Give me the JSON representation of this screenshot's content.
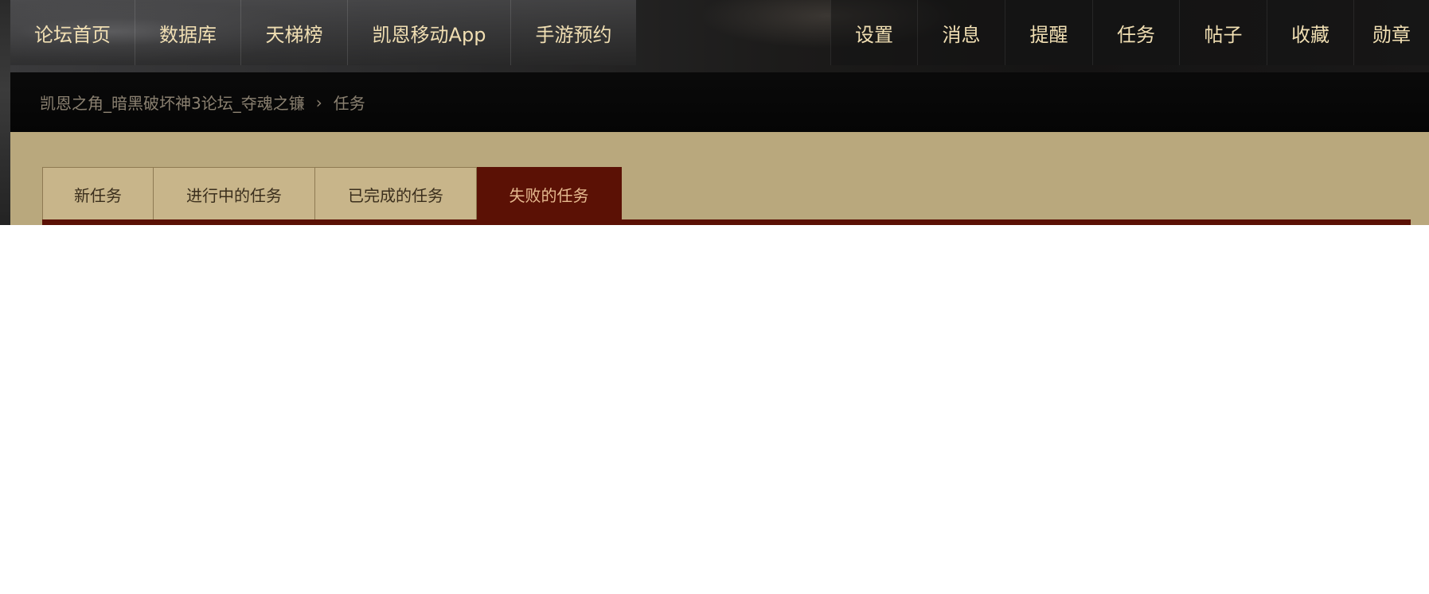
{
  "top_nav": {
    "left_items": [
      {
        "label": "论坛首页"
      },
      {
        "label": "数据库"
      },
      {
        "label": "天梯榜"
      },
      {
        "label": "凯恩移动App"
      },
      {
        "label": "手游预约"
      }
    ],
    "right_items": [
      {
        "label": "设置"
      },
      {
        "label": "消息"
      },
      {
        "label": "提醒"
      },
      {
        "label": "任务"
      },
      {
        "label": "帖子"
      },
      {
        "label": "收藏"
      },
      {
        "label": "勋章"
      }
    ]
  },
  "breadcrumb": {
    "home": "凯恩之角_暗黑破坏神3论坛_夺魂之镰",
    "separator": "›",
    "current": "任务"
  },
  "tabs": {
    "items": [
      {
        "label": "新任务",
        "active": false
      },
      {
        "label": "进行中的任务",
        "active": false
      },
      {
        "label": "已完成的任务",
        "active": false
      },
      {
        "label": "失败的任务",
        "active": true
      }
    ]
  },
  "colors": {
    "nav_text": "#f1dfb3",
    "content_bg": "#b9a87d",
    "tab_bg": "#c8b58a",
    "active_tab_bg": "#5b1105",
    "active_tab_text": "#e6b98f",
    "breadcrumb_text": "#8a8070"
  }
}
